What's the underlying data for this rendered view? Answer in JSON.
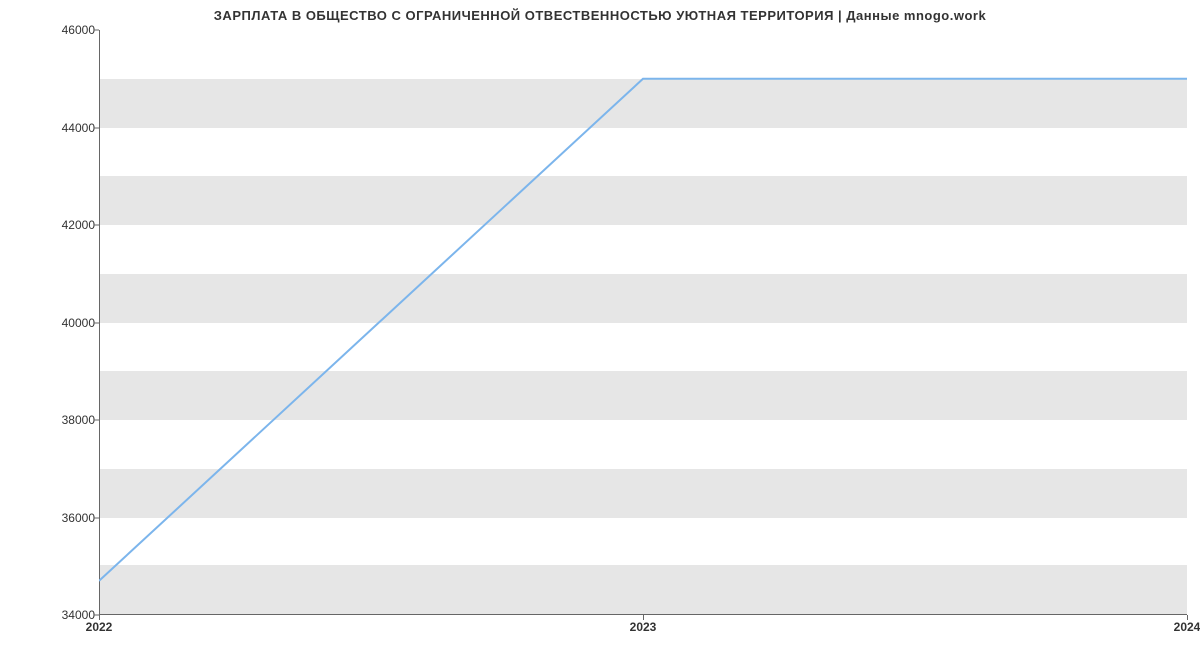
{
  "chart_data": {
    "type": "line",
    "title": "ЗАРПЛАТА В ОБЩЕСТВО С ОГРАНИЧЕННОЙ ОТВЕСТВЕННОСТЬЮ УЮТНАЯ ТЕРРИТОРИЯ | Данные mnogo.work",
    "x": [
      2022,
      2023,
      2024
    ],
    "values": [
      34700,
      45000,
      45000
    ],
    "xlabel": "",
    "ylabel": "",
    "xlim": [
      2022,
      2024
    ],
    "ylim": [
      34000,
      46000
    ],
    "y_ticks": [
      34000,
      36000,
      38000,
      40000,
      42000,
      44000,
      46000
    ],
    "x_ticks": [
      "2022",
      "2023",
      "2024"
    ],
    "line_color": "#7cb5ec",
    "band_color": "#e6e6e6"
  }
}
